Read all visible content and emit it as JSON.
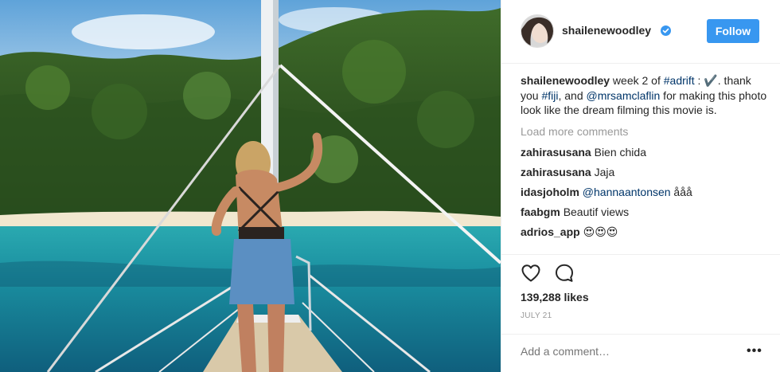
{
  "post": {
    "author": "shailenewoodley",
    "follow_label": "Follow"
  },
  "caption": {
    "username": "shailenewoodley",
    "text_1": " week 2 of ",
    "tag_adrift": "#adrift",
    "text_2": " : ✔️. thank you ",
    "tag_fiji": "#fiji",
    "text_3": ", and ",
    "mention_claflin": "@mrsamclaflin",
    "text_4": " for making this photo look like the dream filming this movie is."
  },
  "load_more": "Load more comments",
  "comments": [
    {
      "username": "zahirasusana",
      "text": "Bien chida"
    },
    {
      "username": "zahirasusana",
      "text": "Jaja"
    },
    {
      "username": "idasjoholm",
      "mention": "@hannaantonsen",
      "text": " ååå"
    },
    {
      "username": "faabgm",
      "text": "Beautif views"
    },
    {
      "username": "adrios_app",
      "text": "😍😍😍"
    }
  ],
  "likes": "139,288 likes",
  "date": "JULY 21",
  "add_comment_placeholder": "Add a comment…",
  "more_options": "•••",
  "colors": {
    "follow_button": "#3897f0",
    "link": "#003569",
    "muted": "#999999",
    "verified": "#3897f0"
  },
  "icons": {
    "verified": "verified-badge-icon",
    "like": "heart-icon",
    "comment": "speech-bubble-icon"
  }
}
